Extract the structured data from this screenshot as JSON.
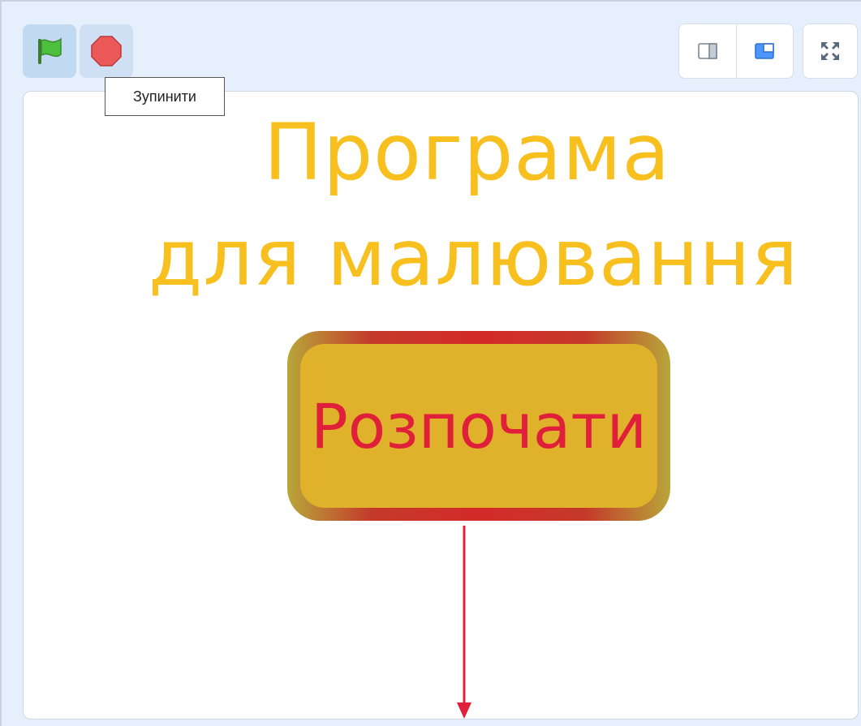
{
  "toolbar": {
    "green_flag_icon": "green-flag-icon",
    "stop_icon": "stop-sign-icon",
    "stop_tooltip": "Зупинити",
    "layout_buttons": [
      "small-stage-icon",
      "normal-stage-icon"
    ],
    "fullscreen_icon": "fullscreen-icon"
  },
  "stage": {
    "title_line1": "Програма",
    "title_line2": "для малювання",
    "start_button_label": "Розпочати"
  },
  "colors": {
    "title": "#f7c01e",
    "start_button_fill": "#e0b12a",
    "start_button_text": "#e0203a",
    "arrow": "#e0203a",
    "toolbar_bg": "#e5f0fc"
  }
}
